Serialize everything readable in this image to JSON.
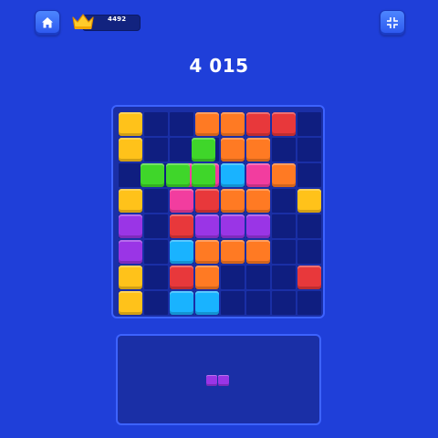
{
  "header": {
    "best_score": "4492",
    "home_icon": "home-icon",
    "crown_icon": "crown-icon",
    "collapse_icon": "collapse-arrows-icon"
  },
  "score": "4 015",
  "colors": {
    "yellow": "#ffc21a",
    "orange": "#ff7a23",
    "red": "#e8383b",
    "pink": "#f23d9f",
    "purple": "#9a35e6",
    "cyan": "#19b3ff",
    "green": "#3fd62a",
    "empty": "#0f1e80"
  },
  "board": {
    "size": 8,
    "cells": [
      [
        "yellow",
        null,
        null,
        "orange",
        "orange",
        "red",
        "red",
        null
      ],
      [
        "yellow",
        null,
        null,
        null,
        "orange",
        "orange",
        null,
        null
      ],
      [
        null,
        null,
        "pink",
        "pink",
        "cyan",
        "pink",
        "orange",
        null
      ],
      [
        "yellow",
        null,
        "pink",
        "red",
        "orange",
        "orange",
        null,
        "yellow"
      ],
      [
        "purple",
        null,
        "red",
        "purple",
        "purple",
        "purple",
        null,
        null
      ],
      [
        "purple",
        null,
        "cyan",
        "orange",
        "orange",
        "orange",
        null,
        null
      ],
      [
        "yellow",
        null,
        "red",
        "orange",
        null,
        null,
        null,
        "red"
      ],
      [
        "yellow",
        null,
        "cyan",
        "cyan",
        null,
        null,
        null,
        null
      ]
    ]
  },
  "dragged_piece": {
    "color": "green",
    "cells": [
      [
        2.85,
        1
      ],
      [
        0.85,
        2
      ],
      [
        1.85,
        2
      ],
      [
        2.85,
        2
      ]
    ]
  },
  "tray": {
    "pieces": [
      {
        "color": "purple",
        "cells": [
          [
            0,
            0
          ],
          [
            1,
            0
          ]
        ]
      }
    ]
  }
}
